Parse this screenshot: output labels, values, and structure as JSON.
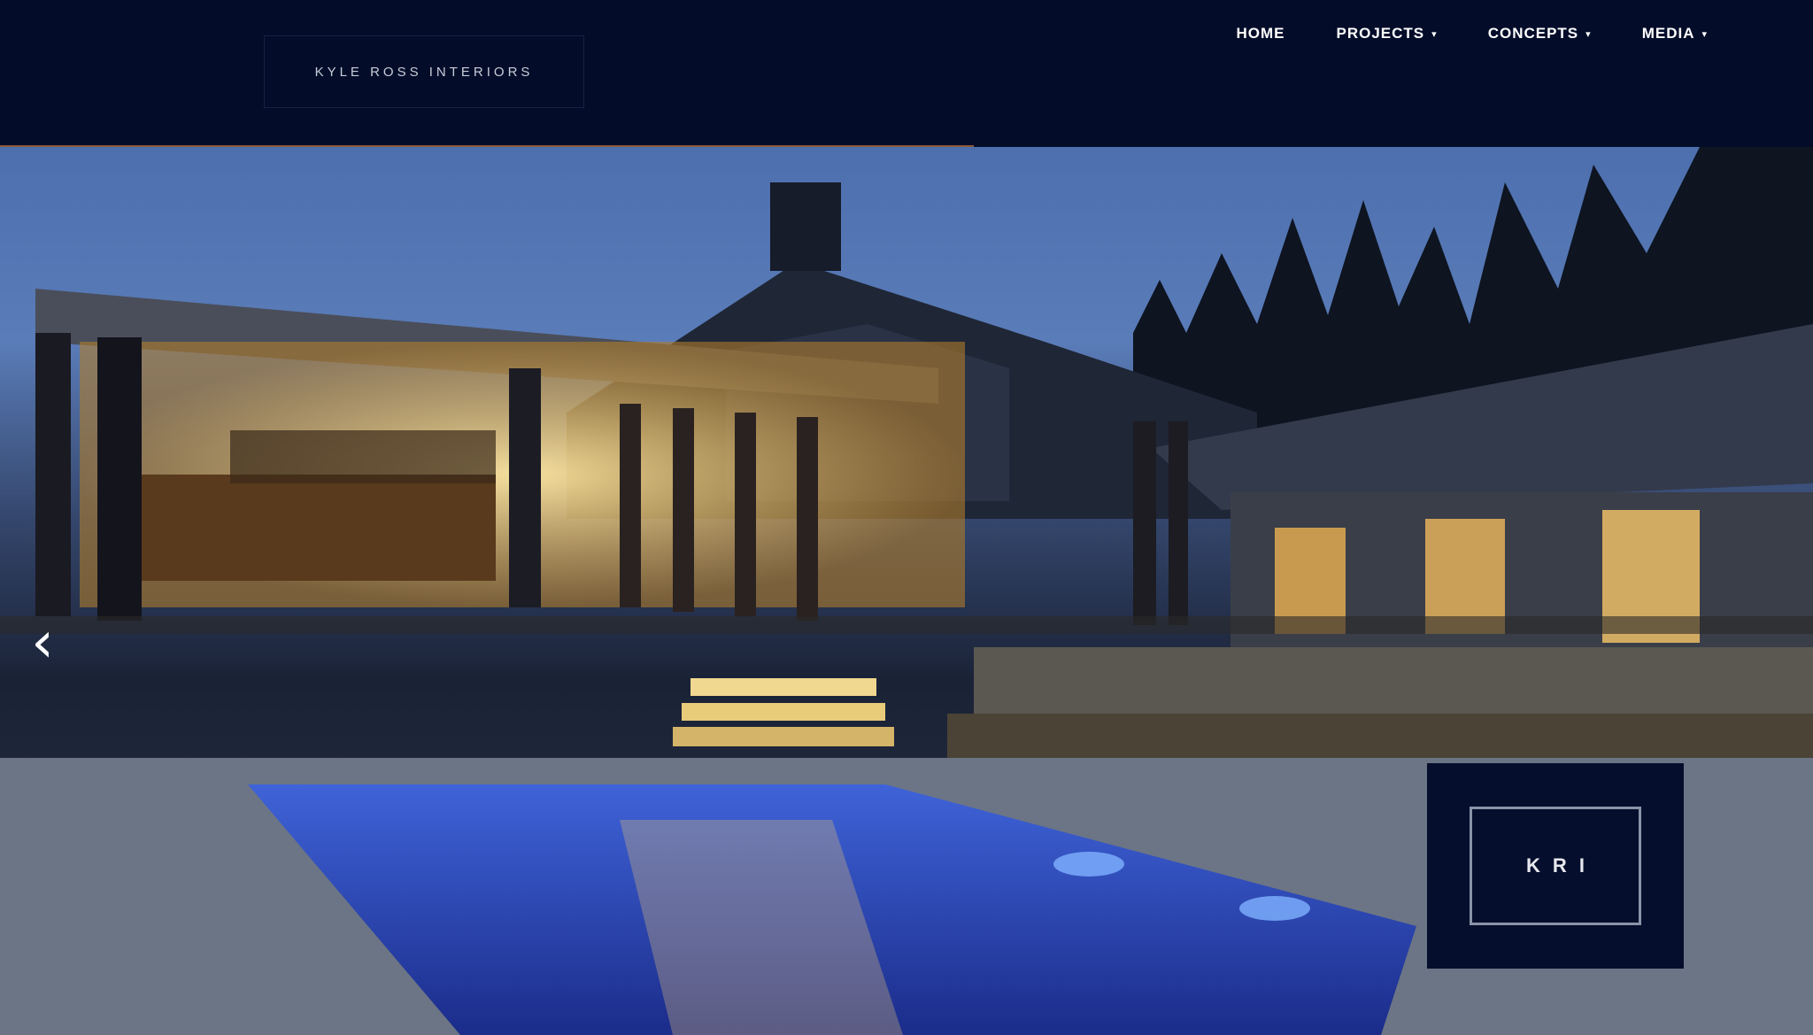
{
  "header": {
    "logo_text": "KYLE ROSS INTERIORS",
    "nav": [
      {
        "label": "HOME",
        "has_dropdown": false
      },
      {
        "label": "PROJECTS",
        "has_dropdown": true
      },
      {
        "label": "CONCEPTS",
        "has_dropdown": true
      },
      {
        "label": "MEDIA",
        "has_dropdown": true
      }
    ]
  },
  "hero": {
    "prev_arrow_icon": "chevron-left-icon",
    "badge_text": "KRI"
  },
  "colors": {
    "header_bg": "#030d2a",
    "badge_bg": "#050f2d",
    "accent_line": "#8a5a3a"
  }
}
